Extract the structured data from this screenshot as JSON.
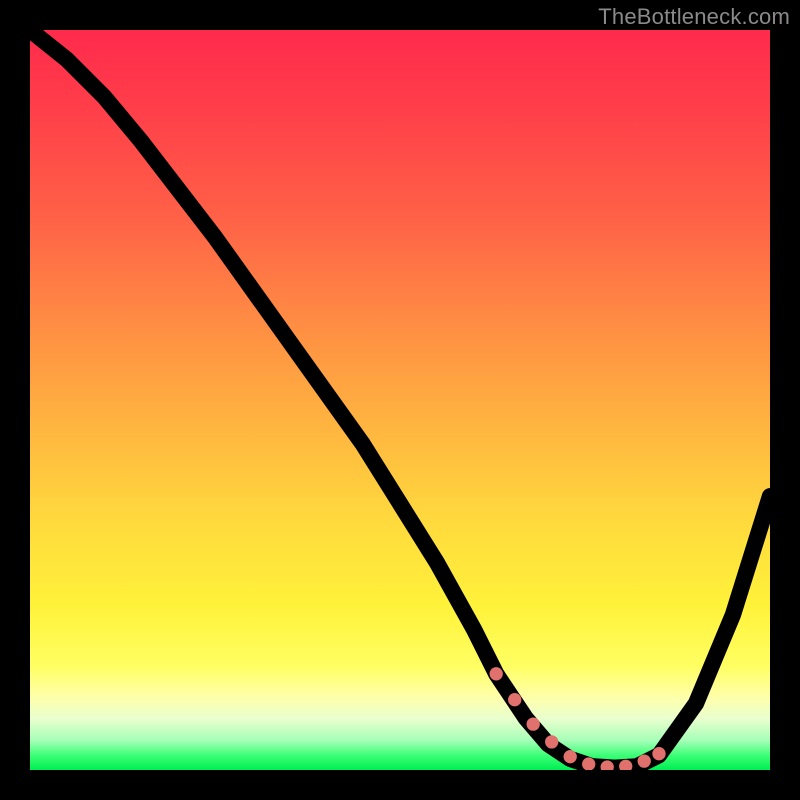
{
  "watermark": "TheBottleneck.com",
  "chart_data": {
    "type": "line",
    "title": "",
    "xlabel": "",
    "ylabel": "",
    "xlim": [
      0,
      100
    ],
    "ylim": [
      0,
      100
    ],
    "grid": false,
    "series": [
      {
        "name": "curve",
        "x": [
          0,
          5,
          10,
          15,
          20,
          25,
          30,
          35,
          40,
          45,
          50,
          55,
          60,
          63,
          67,
          70,
          73,
          76,
          79,
          82,
          85,
          90,
          95,
          100
        ],
        "y": [
          100,
          96,
          91,
          85,
          78.5,
          72,
          65,
          58,
          51,
          44,
          36,
          28,
          19,
          13,
          7,
          3.5,
          1.5,
          0.5,
          0.3,
          0.5,
          2,
          9,
          21,
          37
        ]
      }
    ],
    "markers": {
      "name": "highlight-dots",
      "x": [
        63,
        65.5,
        68,
        70.5,
        73,
        75.5,
        78,
        80.5,
        83,
        85
      ],
      "y": [
        13,
        9.5,
        6.2,
        3.8,
        1.8,
        0.8,
        0.4,
        0.5,
        1.2,
        2.2
      ]
    },
    "background": {
      "type": "vertical-gradient",
      "stops": [
        {
          "pos": 0.0,
          "color": "#ff2a4c"
        },
        {
          "pos": 0.25,
          "color": "#ff6047"
        },
        {
          "pos": 0.52,
          "color": "#ffb040"
        },
        {
          "pos": 0.78,
          "color": "#fff23a"
        },
        {
          "pos": 0.9,
          "color": "#ffffa8"
        },
        {
          "pos": 0.96,
          "color": "#a6ffb8"
        },
        {
          "pos": 1.0,
          "color": "#00ef53"
        }
      ]
    }
  }
}
